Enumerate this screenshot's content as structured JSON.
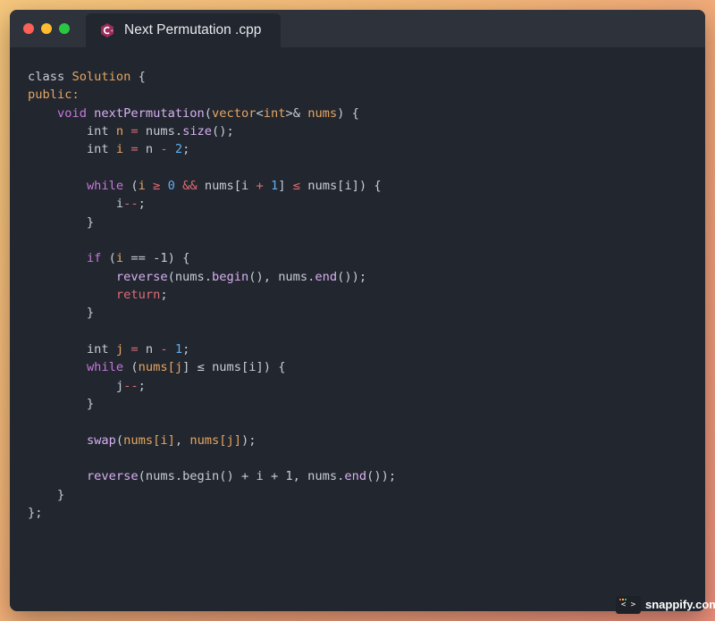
{
  "window": {
    "file_title": "Next Permutation .cpp",
    "file_icon": "cpp-language-icon"
  },
  "editor": {
    "lines": [
      [
        [
          "class ",
          "txt"
        ],
        [
          "Solution ",
          "typ"
        ],
        [
          "{",
          "txt"
        ]
      ],
      [
        [
          "public:",
          "typ"
        ]
      ],
      [
        [
          "    ",
          "txt"
        ],
        [
          "void ",
          "kw"
        ],
        [
          "nextPermutation",
          "fn"
        ],
        [
          "(",
          "txt"
        ],
        [
          "vector",
          "typ"
        ],
        [
          "<",
          "txt"
        ],
        [
          "int",
          "typ"
        ],
        [
          ">& ",
          "txt"
        ],
        [
          "nums",
          "var"
        ],
        [
          ") {",
          "txt"
        ]
      ],
      [
        [
          "        ",
          "txt"
        ],
        [
          "int ",
          "txt"
        ],
        [
          "n ",
          "var"
        ],
        [
          "= ",
          "op"
        ],
        [
          "nums.",
          "txt"
        ],
        [
          "size",
          "fn"
        ],
        [
          "();",
          "txt"
        ]
      ],
      [
        [
          "        ",
          "txt"
        ],
        [
          "int ",
          "txt"
        ],
        [
          "i ",
          "var"
        ],
        [
          "= ",
          "op"
        ],
        [
          "n ",
          "txt"
        ],
        [
          "- ",
          "op"
        ],
        [
          "2",
          "num"
        ],
        [
          ";",
          "txt"
        ]
      ],
      [],
      [
        [
          "        ",
          "txt"
        ],
        [
          "while ",
          "kw"
        ],
        [
          "(",
          "txt"
        ],
        [
          "i ",
          "var"
        ],
        [
          "≥ ",
          "op"
        ],
        [
          "0 ",
          "num"
        ],
        [
          "&& ",
          "op"
        ],
        [
          "nums[i ",
          "txt"
        ],
        [
          "+ ",
          "op"
        ],
        [
          "1",
          "num"
        ],
        [
          "] ",
          "txt"
        ],
        [
          "≤ ",
          "op"
        ],
        [
          "nums[i]) {",
          "txt"
        ]
      ],
      [
        [
          "            ",
          "txt"
        ],
        [
          "i",
          "txt"
        ],
        [
          "--",
          "op"
        ],
        [
          ";",
          "txt"
        ]
      ],
      [
        [
          "        }",
          "txt"
        ]
      ],
      [],
      [
        [
          "        ",
          "txt"
        ],
        [
          "if ",
          "kw"
        ],
        [
          "(",
          "txt"
        ],
        [
          "i ",
          "var"
        ],
        [
          "== ",
          "txt"
        ],
        [
          "-1) {",
          "txt"
        ]
      ],
      [
        [
          "            ",
          "txt"
        ],
        [
          "reverse",
          "fn"
        ],
        [
          "(nums.",
          "txt"
        ],
        [
          "begin",
          "fn"
        ],
        [
          "(), nums.",
          "txt"
        ],
        [
          "end",
          "fn"
        ],
        [
          "());",
          "txt"
        ]
      ],
      [
        [
          "            ",
          "txt"
        ],
        [
          "return",
          "kw-red"
        ],
        [
          ";",
          "txt"
        ]
      ],
      [
        [
          "        }",
          "txt"
        ]
      ],
      [],
      [
        [
          "        ",
          "txt"
        ],
        [
          "int ",
          "txt"
        ],
        [
          "j ",
          "var"
        ],
        [
          "= ",
          "op"
        ],
        [
          "n ",
          "txt"
        ],
        [
          "- ",
          "op"
        ],
        [
          "1",
          "num"
        ],
        [
          ";",
          "txt"
        ]
      ],
      [
        [
          "        ",
          "txt"
        ],
        [
          "while ",
          "kw"
        ],
        [
          "(",
          "txt"
        ],
        [
          "nums[",
          "var"
        ],
        [
          "j",
          "var"
        ],
        [
          "] ",
          "txt"
        ],
        [
          "≤ ",
          "txt"
        ],
        [
          "nums[i]) {",
          "txt"
        ]
      ],
      [
        [
          "            ",
          "txt"
        ],
        [
          "j",
          "txt"
        ],
        [
          "--",
          "op"
        ],
        [
          ";",
          "txt"
        ]
      ],
      [
        [
          "        }",
          "txt"
        ]
      ],
      [],
      [
        [
          "        ",
          "txt"
        ],
        [
          "swap",
          "fn"
        ],
        [
          "(",
          "txt"
        ],
        [
          "nums[i]",
          "var"
        ],
        [
          ", ",
          "txt"
        ],
        [
          "nums[j]",
          "var"
        ],
        [
          ");",
          "txt"
        ]
      ],
      [],
      [
        [
          "        ",
          "txt"
        ],
        [
          "reverse",
          "fn"
        ],
        [
          "(nums.begin() + i + 1, nums.",
          "txt"
        ],
        [
          "end",
          "fn"
        ],
        [
          "());",
          "txt"
        ]
      ],
      [
        [
          "    }",
          "txt"
        ]
      ],
      [
        [
          "};",
          "txt"
        ]
      ]
    ]
  },
  "watermark": {
    "badge": "< >",
    "brand": "snappify.com"
  }
}
